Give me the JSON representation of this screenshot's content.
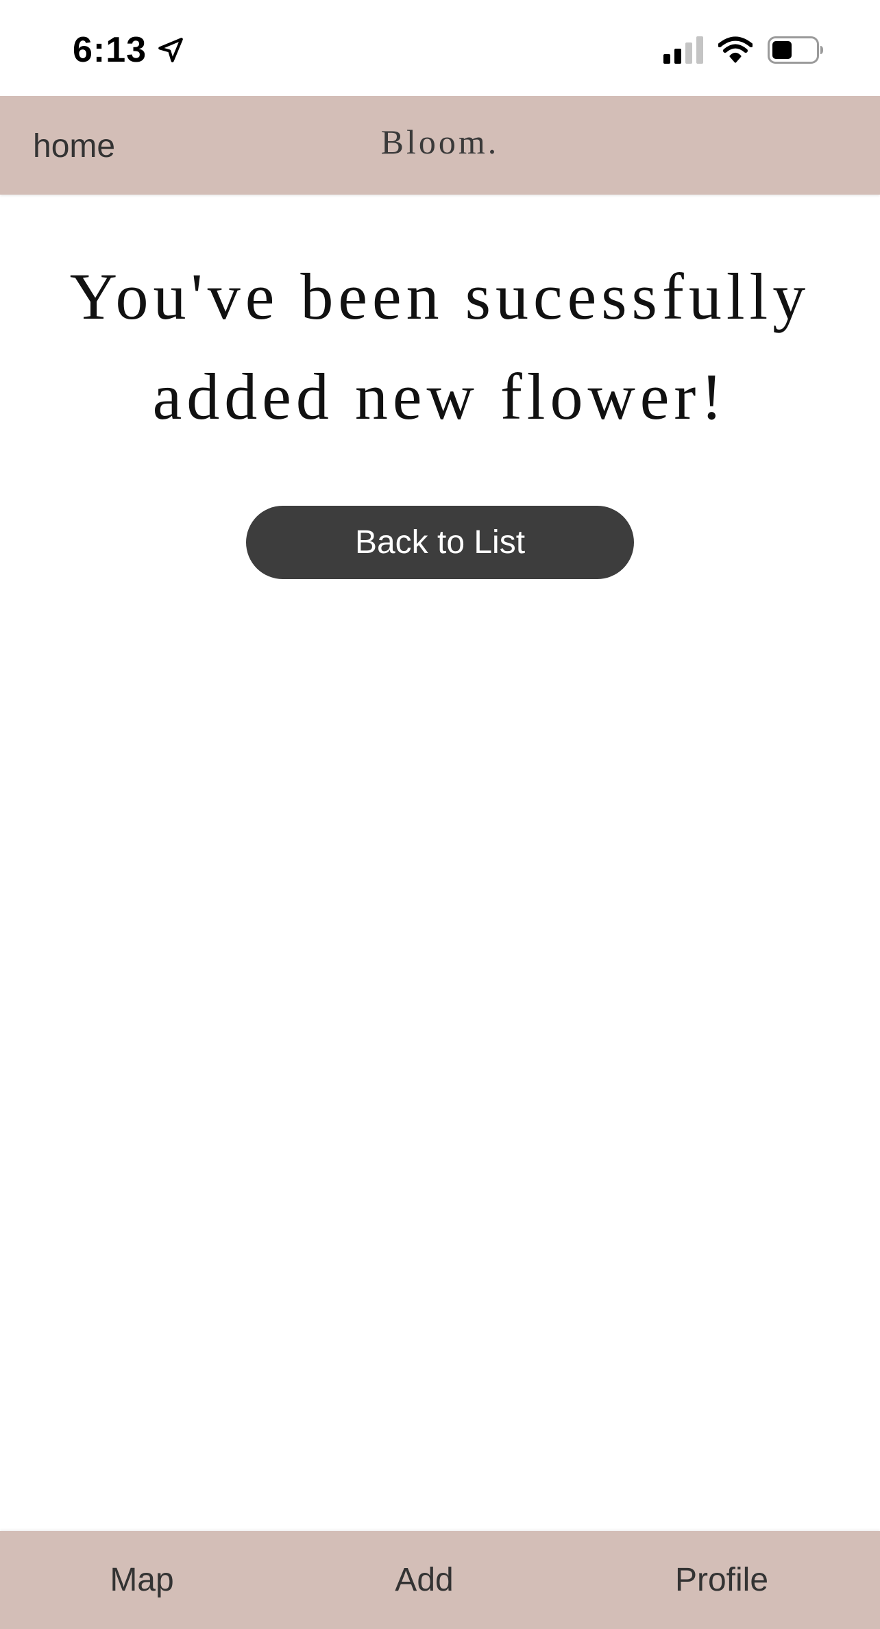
{
  "status_bar": {
    "time": "6:13",
    "icons": [
      "location-arrow-icon",
      "signal-icon",
      "wifi-icon",
      "battery-icon"
    ]
  },
  "header": {
    "home_label": "home",
    "brand": "Bloom."
  },
  "main": {
    "message": "You've been sucessfully added new flower!",
    "back_button_label": "Back to List"
  },
  "tab_bar": {
    "tabs": [
      {
        "label": "Map"
      },
      {
        "label": "Add"
      },
      {
        "label": "Profile"
      }
    ]
  },
  "colors": {
    "bar_background": "#d3beb7",
    "button_background": "#3d3d3d",
    "button_text": "#ffffff",
    "page_background": "#ffffff"
  }
}
